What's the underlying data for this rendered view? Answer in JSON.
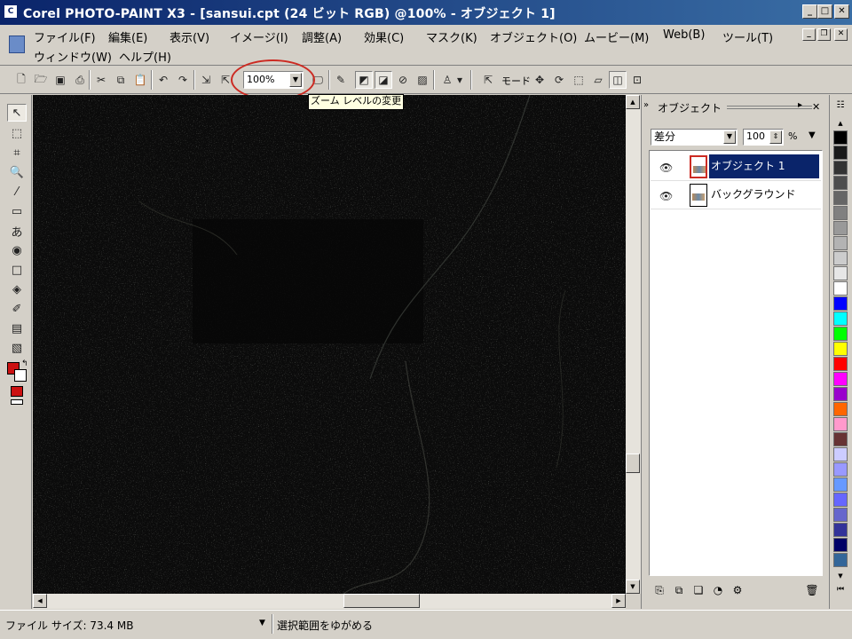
{
  "window": {
    "title": "Corel PHOTO-PAINT X3 - [sansui.cpt (24 ビット RGB) @100% - オブジェクト 1]",
    "app_icon_glyph": "C",
    "minimize_glyph": "_",
    "maximize_glyph": "□",
    "close_glyph": "✕"
  },
  "menu": {
    "items": [
      {
        "label": "ファイル(F)"
      },
      {
        "label": "編集(E)"
      },
      {
        "label": "表示(V)"
      },
      {
        "label": "イメージ(I)"
      },
      {
        "label": "調整(A)"
      },
      {
        "label": "効果(C)"
      },
      {
        "label": "マスク(K)"
      },
      {
        "label": "オブジェクト(O)"
      },
      {
        "label": "ムービー(M)"
      },
      {
        "label": "Web(B)"
      },
      {
        "label": "ツール(T)"
      },
      {
        "label": "ウィンドウ(W)"
      },
      {
        "label": "ヘルプ(H)"
      }
    ]
  },
  "toolbar": {
    "zoom_value": "100%",
    "zoom_tooltip": "ズーム レベルの変更",
    "mode_label": "モード"
  },
  "docker": {
    "title": "オブジェクト",
    "collapse_glyph": "»",
    "menu_glyph": "▸",
    "close_glyph": "✕",
    "blend_mode": "差分",
    "opacity": "100",
    "opacity_unit": "%",
    "objects": [
      {
        "name": "オブジェクト 1",
        "selected": true
      },
      {
        "name": "バックグラウンド",
        "selected": false
      }
    ]
  },
  "palette": {
    "colors": [
      "#000000",
      "#1a1a1a",
      "#333333",
      "#4d4d4d",
      "#666666",
      "#808080",
      "#999999",
      "#b3b3b3",
      "#cccccc",
      "#e6e6e6",
      "#ffffff",
      "#0000ff",
      "#00ffff",
      "#00ff00",
      "#ffff00",
      "#ff0000",
      "#ff00ff",
      "#9900cc",
      "#ff6600",
      "#ff99cc",
      "#663333",
      "#ccccff",
      "#9999ff",
      "#6699ff",
      "#6666ff",
      "#6666cc",
      "#333399",
      "#000066",
      "#336699"
    ]
  },
  "colors": {
    "foreground": "#cc1111",
    "background": "#ffffff",
    "accent": "#cc2a22",
    "title_start": "#0a246a",
    "title_end": "#3a6ea5"
  },
  "status": {
    "file_size": "ファイル サイズ: 73.4 MB",
    "hint": "選択範囲をゆがめる"
  }
}
